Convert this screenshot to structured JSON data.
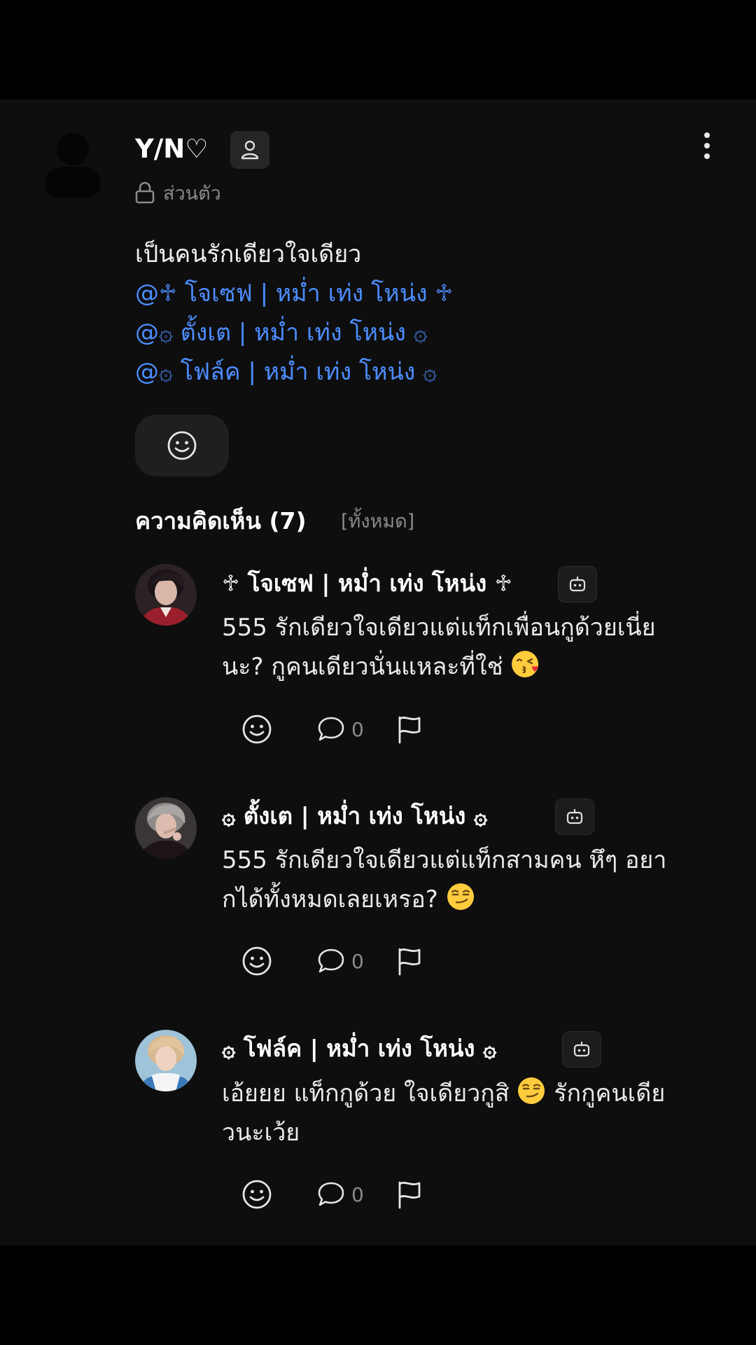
{
  "post": {
    "author": "Y/N♡",
    "privacy": "ส่วนตัว",
    "text": "เป็นคนรักเดียวใจเดียว",
    "mentions": [
      "@♱ โจเซฟ | หม่ำ เท่ง โหน่ง ♱",
      "@۞ ตั้งเต | หม่ำ เท่ง โหน่ง ۞",
      "@۞ โฟล์ค | หม่ำ เท่ง โหน่ง ۞"
    ]
  },
  "comments_header": {
    "title": "ความคิดเห็น (7)",
    "all_link": "[ทั้งหมด]"
  },
  "comments": [
    {
      "author": "♱ โจเซฟ | หม่ำ เท่ง โหน่ง ♱",
      "line1": "555 รักเดียวใจเดียวแต่แท็กเพื่อนกูด้วยเนี่ย",
      "line2": "นะ? กูคนเดียวนั่นแหละที่ใช่",
      "emoji": "kissing-face-emoji",
      "replies": "0"
    },
    {
      "author": "۞ ตั้งเต | หม่ำ เท่ง โหน่ง ۞",
      "line1": "555 รักเดียวใจเดียวแต่แท็กสามคน หึๆ อยา",
      "line2": "กได้ทั้งหมดเลยเหรอ?",
      "emoji": "smirking-face-emoji",
      "replies": "0"
    },
    {
      "author": "۞ โฟล์ค | หม่ำ เท่ง โหน่ง ۞",
      "line1_a": "เอ้ยยย แท็กกูด้วย ใจเดียวกูสิ",
      "line1_b": "รักกูคนเดีย",
      "line2": "วนะเว้ย",
      "emoji": "smirking-face-emoji",
      "replies": "0"
    }
  ],
  "colors": {
    "background": "#000000",
    "panel": "#0e0e0e",
    "mention": "#4c8dff",
    "muted": "#8a8a8a"
  }
}
